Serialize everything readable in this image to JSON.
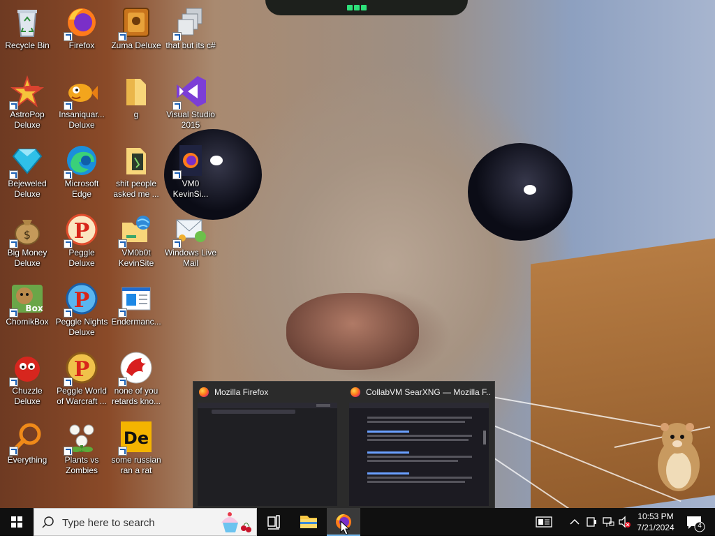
{
  "desktop": {
    "icons": [
      {
        "label": "Recycle Bin",
        "icon": "recycle-bin-icon"
      },
      {
        "label": "AstroPop Deluxe",
        "icon": "astropop-icon"
      },
      {
        "label": "Bejeweled Deluxe",
        "icon": "bejeweled-icon"
      },
      {
        "label": "Big Money Deluxe",
        "icon": "money-bag-icon"
      },
      {
        "label": "ChomikBox",
        "icon": "chomikbox-icon"
      },
      {
        "label": "Chuzzle Deluxe",
        "icon": "chuzzle-icon"
      },
      {
        "label": "Everything",
        "icon": "magnifier-icon"
      },
      {
        "label": "Firefox",
        "icon": "firefox-icon"
      },
      {
        "label": "Insaniquar... Deluxe",
        "icon": "insaniquarium-icon"
      },
      {
        "label": "Microsoft Edge",
        "icon": "edge-icon"
      },
      {
        "label": "Peggle Deluxe",
        "icon": "peggle-icon"
      },
      {
        "label": "Peggle Nights Deluxe",
        "icon": "peggle-nights-icon"
      },
      {
        "label": "Peggle World of Warcraft ...",
        "icon": "peggle-wow-icon"
      },
      {
        "label": "Plants vs Zombies",
        "icon": "plants-vs-zombies-icon"
      },
      {
        "label": "Zuma Deluxe",
        "icon": "zuma-icon"
      },
      {
        "label": "g",
        "icon": "folder-icon"
      },
      {
        "label": "shit people asked me ...",
        "icon": "document-folder-icon"
      },
      {
        "label": "VM0b0t KevinSite",
        "icon": "folder-globe-icon"
      },
      {
        "label": "Endermanc...",
        "icon": "window-app-icon"
      },
      {
        "label": "none of you retards kno...",
        "icon": "red-dragon-icon"
      },
      {
        "label": "some russian ran a rat",
        "icon": "de-app-icon"
      },
      {
        "label": "that but its c#",
        "icon": "stacked-windows-icon"
      },
      {
        "label": "Visual Studio 2015",
        "icon": "visual-studio-icon"
      },
      {
        "label": "VM0 KevinSi...",
        "icon": "firefox-doc-icon"
      },
      {
        "label": "Windows Live Mail",
        "icon": "live-mail-icon"
      }
    ]
  },
  "thumbnails": [
    {
      "title": "Mozilla Firefox",
      "icon": "firefox-icon"
    },
    {
      "title": "CollabVM SearXNG — Mozilla F...",
      "icon": "firefox-icon"
    }
  ],
  "taskbar": {
    "search_placeholder": "Type here to search",
    "pinned": [
      {
        "name": "task-view",
        "icon": "task-view-icon"
      },
      {
        "name": "file-explorer",
        "icon": "folder-icon"
      },
      {
        "name": "firefox",
        "icon": "firefox-icon",
        "active": true
      }
    ],
    "tray": {
      "time": "10:53 PM",
      "date": "7/21/2024",
      "notification_count": "4"
    }
  }
}
